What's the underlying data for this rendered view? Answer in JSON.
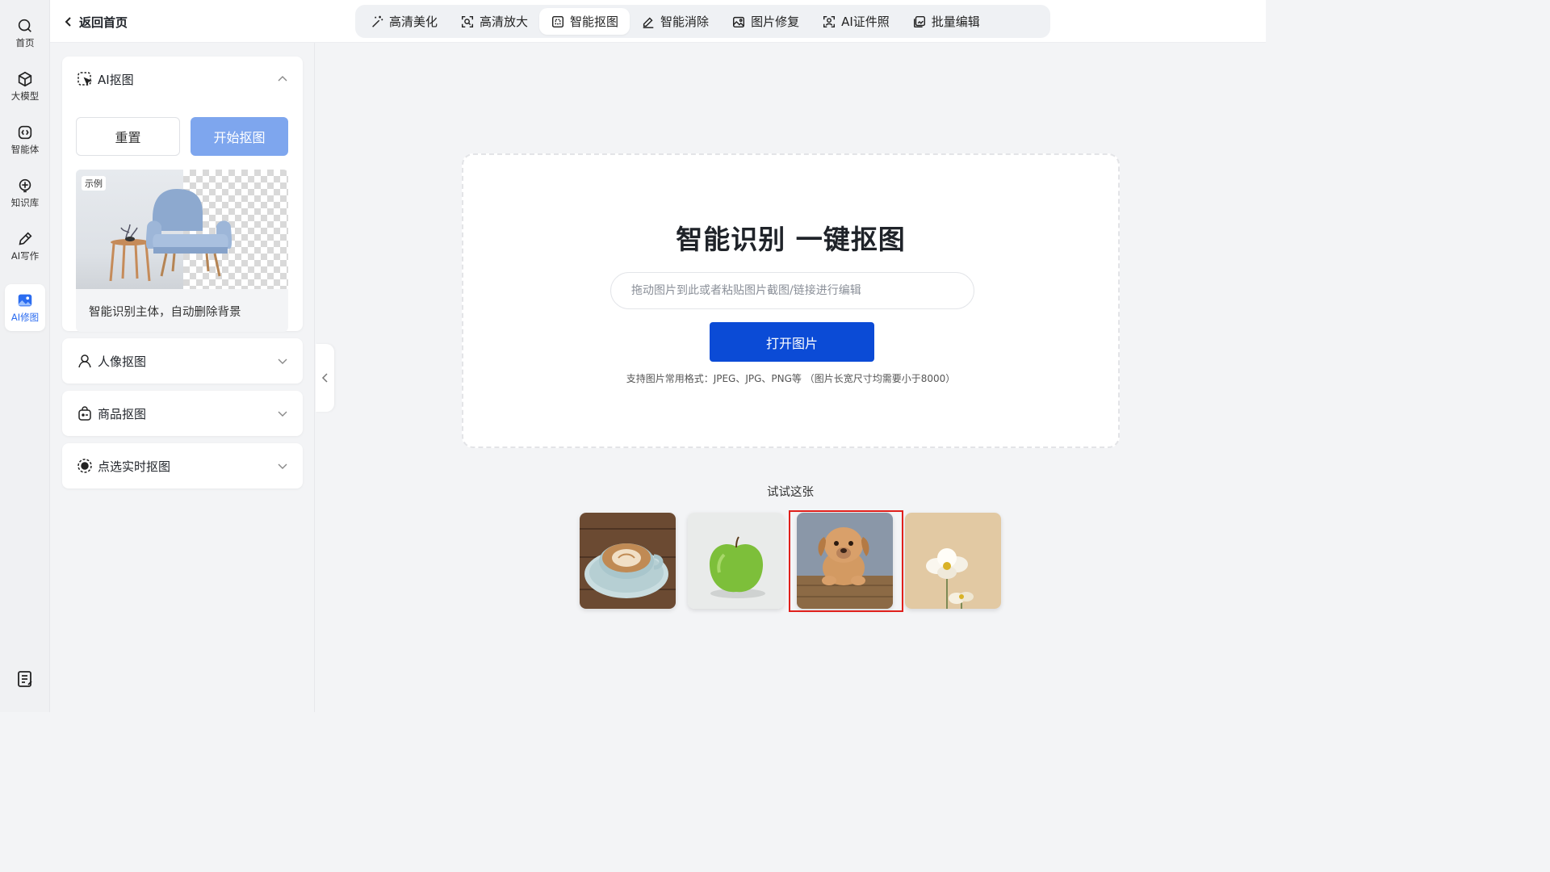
{
  "sidebar": {
    "items": [
      {
        "label": "首页",
        "icon": "search-icon"
      },
      {
        "label": "大模型",
        "icon": "cube-icon"
      },
      {
        "label": "智能体",
        "icon": "agent-icon"
      },
      {
        "label": "知识库",
        "icon": "bulb-icon"
      },
      {
        "label": "AI写作",
        "icon": "pen-icon"
      },
      {
        "label": "AI修图",
        "icon": "image-icon",
        "active": true
      }
    ],
    "bottom_icon": "notes-icon"
  },
  "topbar": {
    "back_label": "返回首页",
    "tabs": [
      {
        "label": "高清美化",
        "icon": "magic-wand-icon"
      },
      {
        "label": "高清放大",
        "icon": "zoom-frame-icon"
      },
      {
        "label": "智能抠图",
        "icon": "cutout-icon",
        "active": true
      },
      {
        "label": "智能消除",
        "icon": "eraser-icon"
      },
      {
        "label": "图片修复",
        "icon": "photo-repair-icon"
      },
      {
        "label": "AI证件照",
        "icon": "id-photo-icon"
      },
      {
        "label": "批量编辑",
        "icon": "batch-edit-icon"
      }
    ]
  },
  "panel": {
    "ai_cutout": {
      "title": "AI抠图",
      "reset_label": "重置",
      "start_label": "开始抠图",
      "example_badge": "示例",
      "example_caption": "智能识别主体，自动删除背景"
    },
    "sections": [
      {
        "title": "人像抠图",
        "icon": "person-icon"
      },
      {
        "title": "商品抠图",
        "icon": "bag-icon"
      },
      {
        "title": "点选实时抠图",
        "icon": "target-icon"
      }
    ]
  },
  "main": {
    "title": "智能识别 一键抠图",
    "input_placeholder": "拖动图片到此或者粘贴图片截图/链接进行编辑",
    "open_label": "打开图片",
    "format_note": "支持图片常用格式：JPEG、JPG、PNG等 （图片长宽尺寸均需要小于8000）",
    "try_label": "试试这张",
    "samples": [
      "coffee-cup",
      "green-apple",
      "puppy",
      "white-flower"
    ]
  },
  "colors": {
    "accent": "#0b4bd6",
    "start_button": "#7ea6ee",
    "active_icon": "#2b6cf0",
    "highlight": "#e0201c"
  }
}
